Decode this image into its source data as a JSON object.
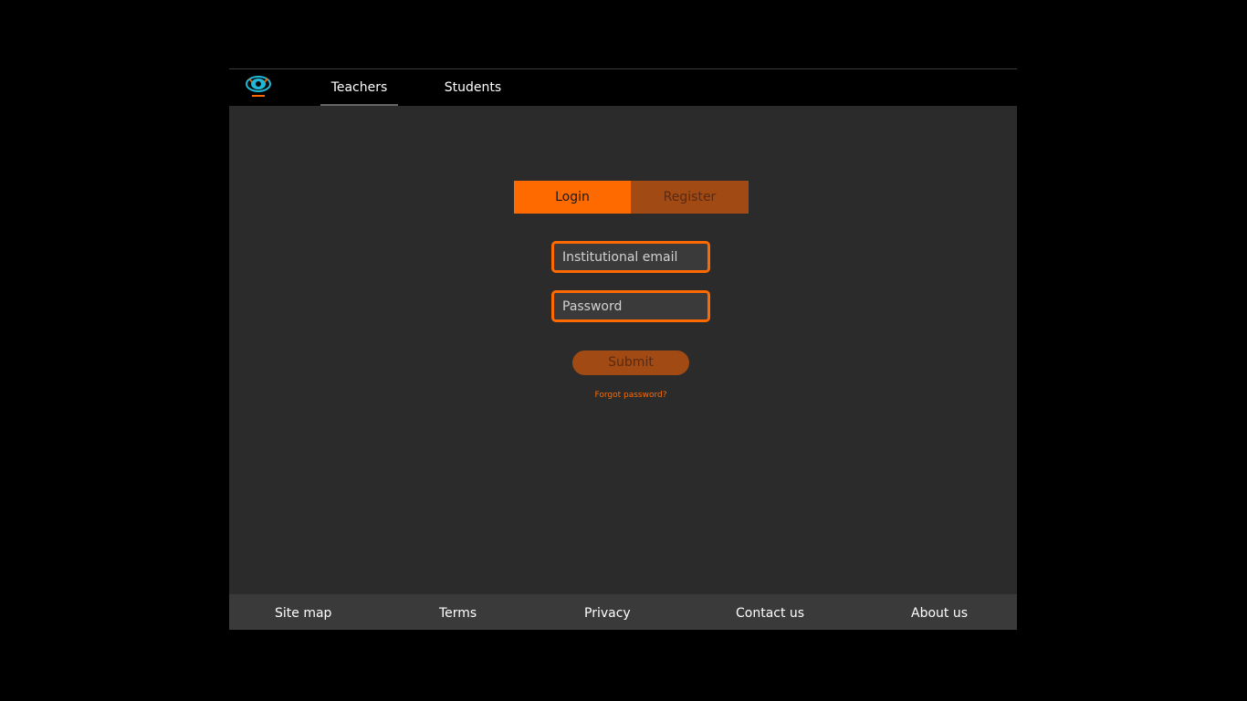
{
  "nav": {
    "tabs": [
      "Teachers",
      "Students"
    ],
    "active_tab": "Teachers"
  },
  "auth": {
    "login_label": "Login",
    "register_label": "Register",
    "email_placeholder": "Institutional email",
    "password_placeholder": "Password",
    "submit_label": "Submit",
    "forgot_label": "Forgot password?"
  },
  "footer": {
    "links": [
      "Site map",
      "Terms",
      "Privacy",
      "Contact us",
      "About us"
    ]
  },
  "colors": {
    "accent": "#ff6a00",
    "accent_dark": "#a14a14",
    "accent_text_dark": "#5a2a12",
    "panel": "#2b2b2b",
    "footer": "#3a3a3a"
  }
}
